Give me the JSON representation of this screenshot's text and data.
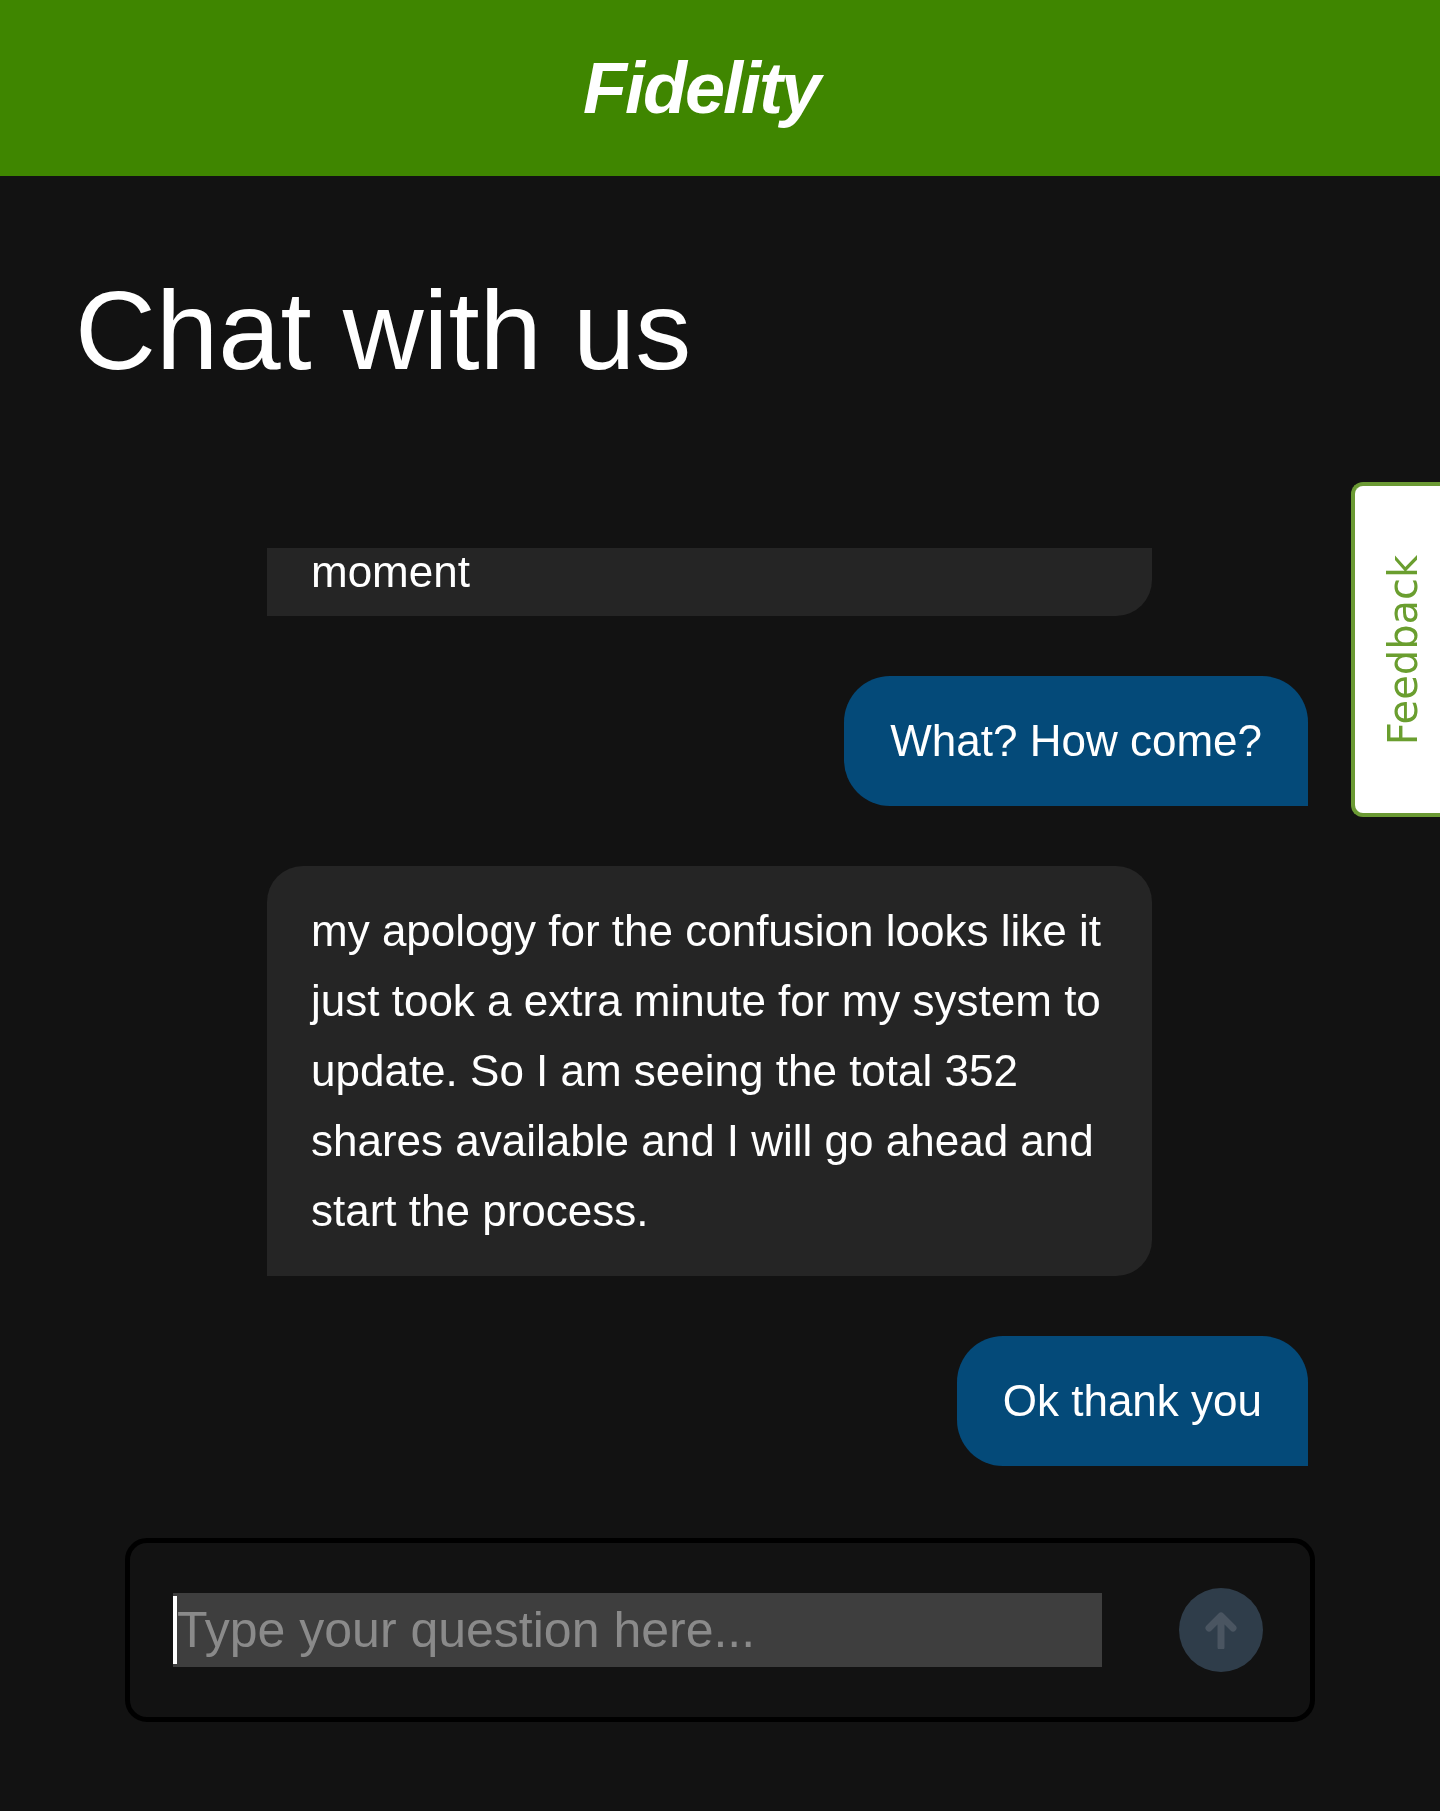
{
  "header": {
    "logo": "Fidelity"
  },
  "title": "Chat with us",
  "feedback_tab": "Feedback",
  "messages": [
    {
      "kind": "agent",
      "text": "moment"
    },
    {
      "kind": "user",
      "text": "What? How come?"
    },
    {
      "kind": "agent",
      "text": "my apology for the confusion looks like it just took a extra minute for my system to update. So I am seeing the total 352 shares available and I will go ahead and start the process."
    },
    {
      "kind": "user",
      "text": "Ok thank you"
    }
  ],
  "composer": {
    "placeholder": "Type your question here..."
  }
}
